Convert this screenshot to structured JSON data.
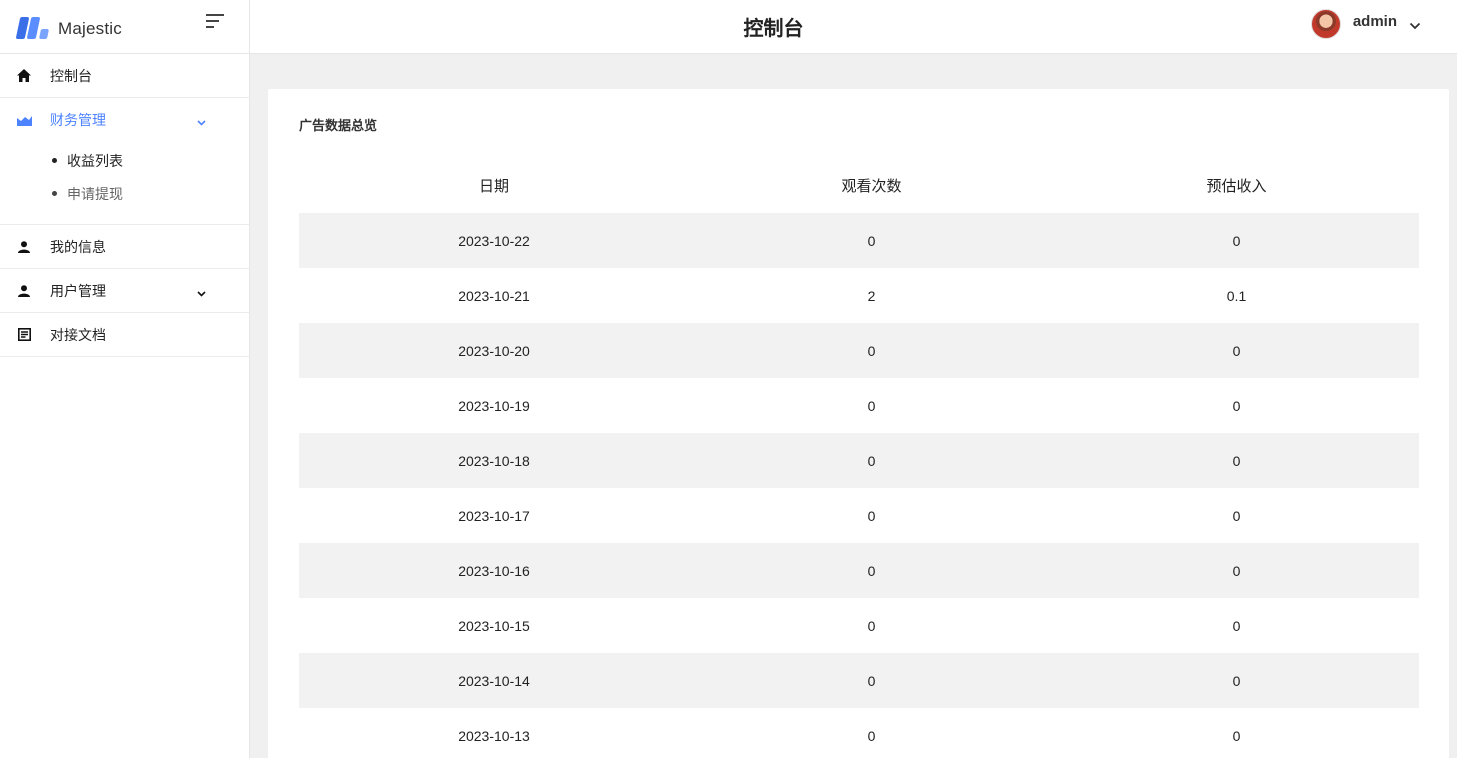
{
  "brand": {
    "name": "Majestic"
  },
  "header": {
    "title": "控制台",
    "user": "admin"
  },
  "sidebar": {
    "items": [
      {
        "label": "控制台",
        "icon": "home-icon"
      },
      {
        "label": "财务管理",
        "icon": "chart-icon",
        "active": true,
        "children": [
          {
            "label": "收益列表"
          },
          {
            "label": "申请提现"
          }
        ]
      },
      {
        "label": "我的信息",
        "icon": "user-icon"
      },
      {
        "label": "用户管理",
        "icon": "user-icon"
      },
      {
        "label": "对接文档",
        "icon": "document-icon"
      }
    ]
  },
  "card": {
    "title": "广告数据总览",
    "columns": [
      "日期",
      "观看次数",
      "预估收入"
    ],
    "rows": [
      [
        "2023-10-22",
        "0",
        "0"
      ],
      [
        "2023-10-21",
        "2",
        "0.1"
      ],
      [
        "2023-10-20",
        "0",
        "0"
      ],
      [
        "2023-10-19",
        "0",
        "0"
      ],
      [
        "2023-10-18",
        "0",
        "0"
      ],
      [
        "2023-10-17",
        "0",
        "0"
      ],
      [
        "2023-10-16",
        "0",
        "0"
      ],
      [
        "2023-10-15",
        "0",
        "0"
      ],
      [
        "2023-10-14",
        "0",
        "0"
      ],
      [
        "2023-10-13",
        "0",
        "0"
      ]
    ]
  },
  "colors": {
    "accent": "#4d83ff",
    "stripe": "#f2f2f2"
  }
}
